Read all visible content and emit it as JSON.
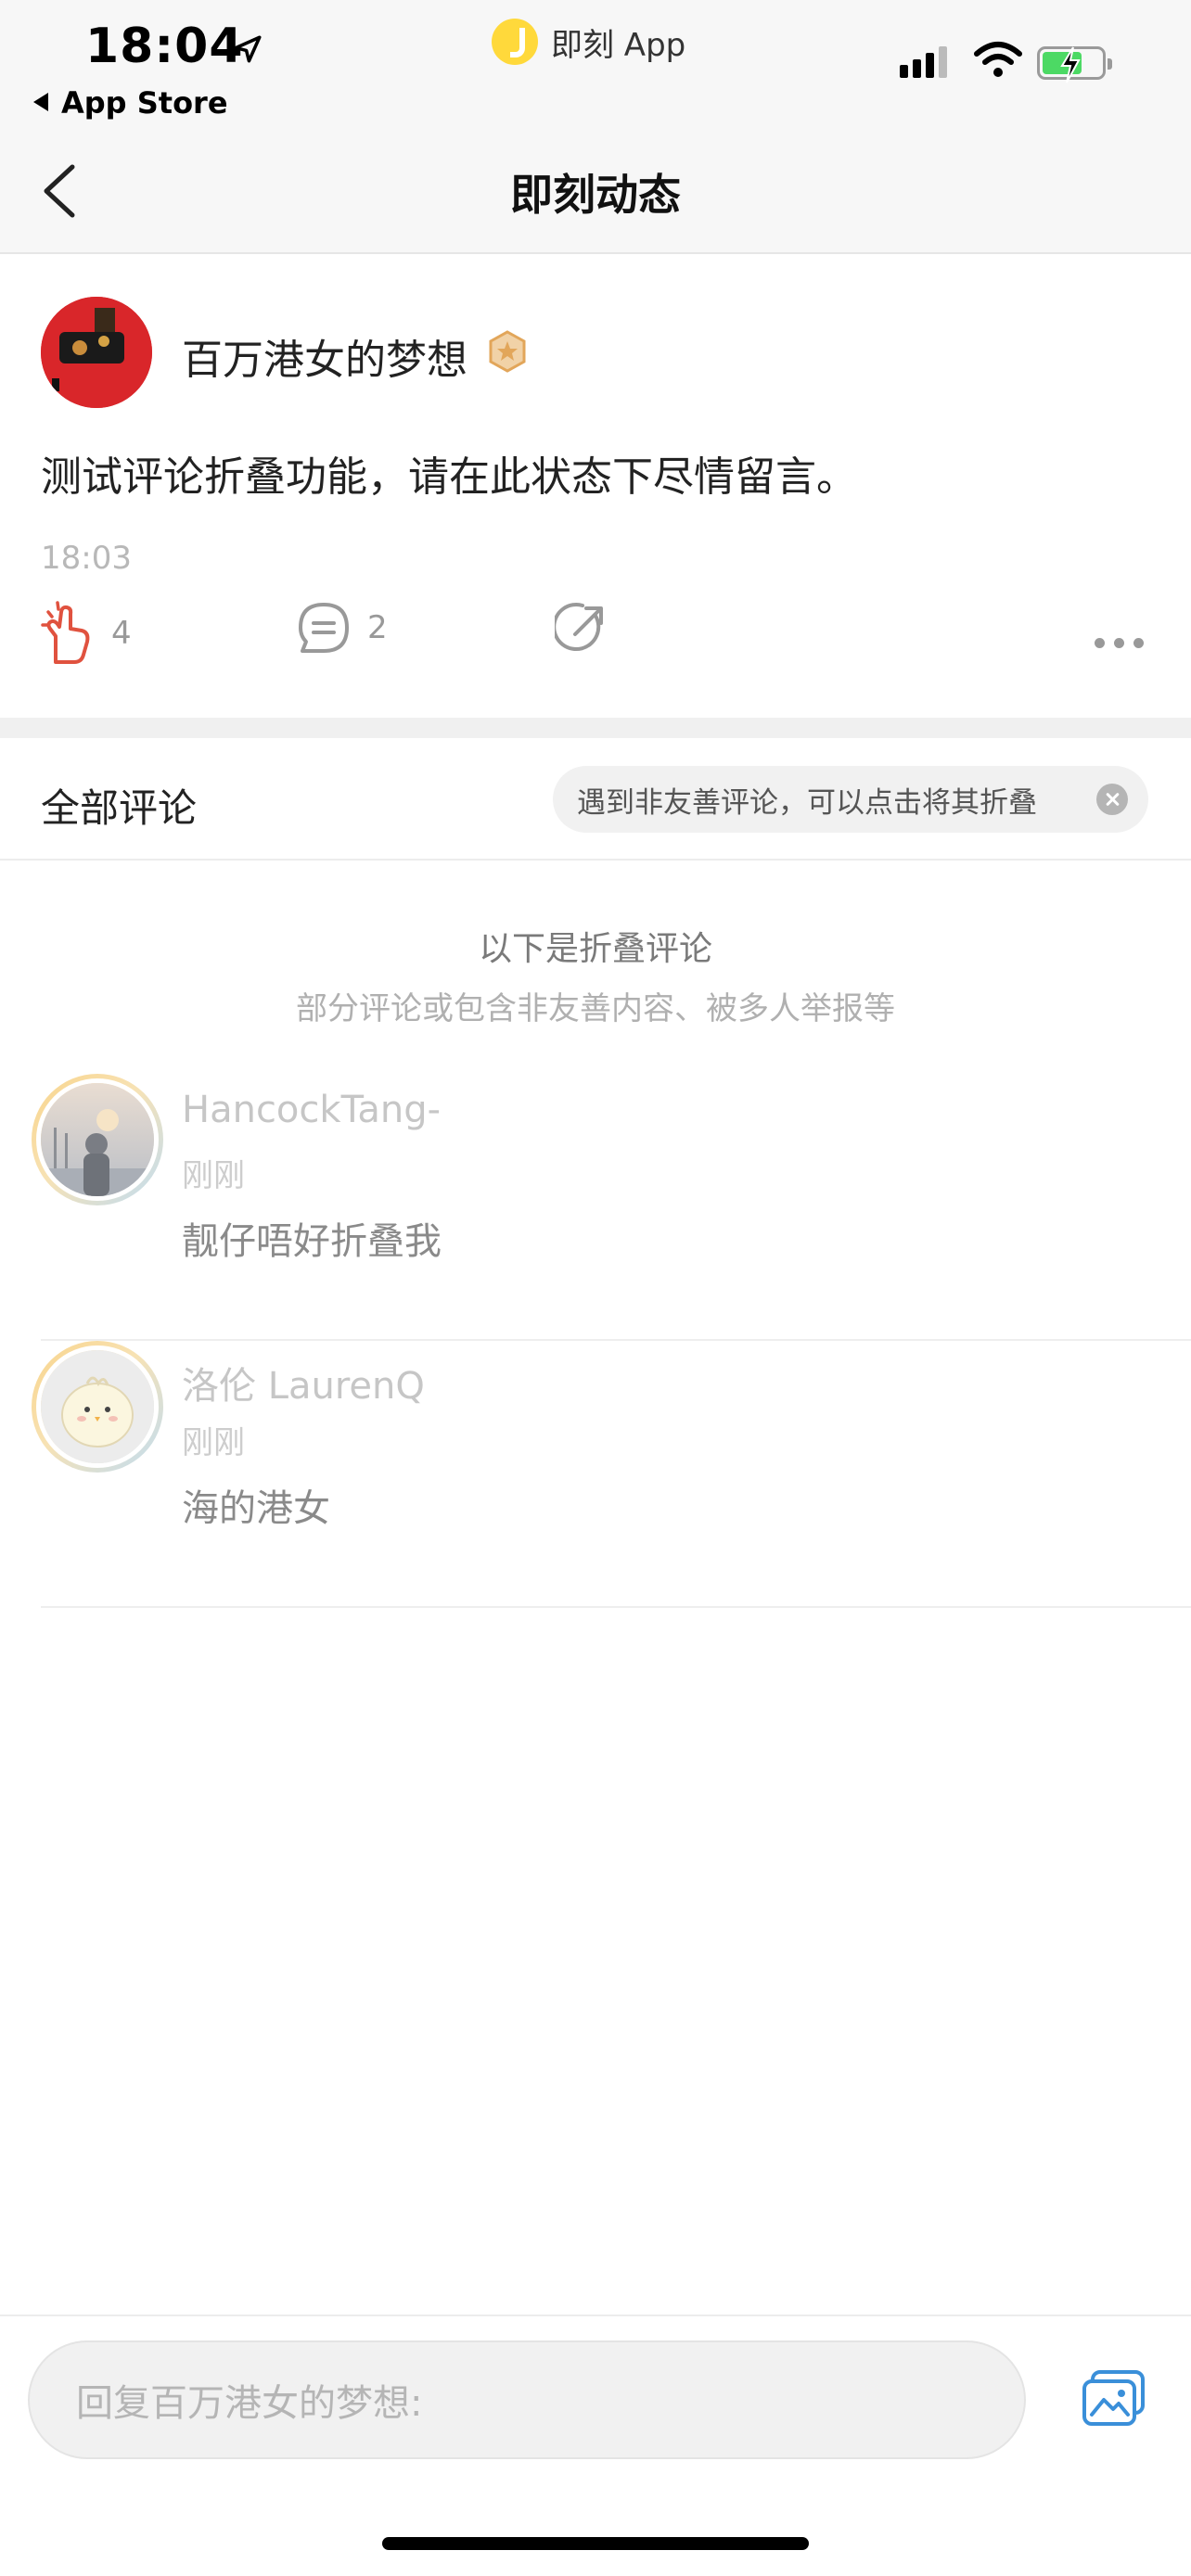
{
  "status_bar": {
    "time": "18:04",
    "back_app": "App Store",
    "island_app": "即刻 App"
  },
  "nav": {
    "title": "即刻动态"
  },
  "post": {
    "author": "百万港女的梦想",
    "text": "测试评论折叠功能，请在此状态下尽情留言。",
    "time": "18:03",
    "likes": "4",
    "comments": "2"
  },
  "comments_section": {
    "title": "全部评论",
    "tip": "遇到非友善评论，可以点击将其折叠",
    "folded_title": "以下是折叠评论",
    "folded_subtitle": "部分评论或包含非友善内容、被多人举报等",
    "items": [
      {
        "name": "HancockTang-",
        "time": "刚刚",
        "text": "靓仔唔好折叠我"
      },
      {
        "name": "洛伦 LaurenQ",
        "time": "刚刚",
        "text": "海的港女"
      }
    ]
  },
  "reply": {
    "placeholder": "回复百万港女的梦想:"
  },
  "colors": {
    "accent_red": "#d9262a",
    "link_blue": "#3a8fd9",
    "badge_gold": "#e2a65a"
  }
}
